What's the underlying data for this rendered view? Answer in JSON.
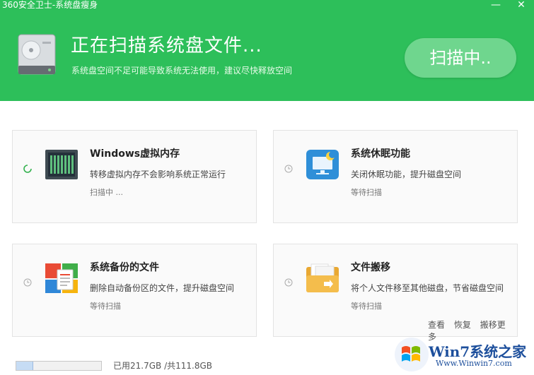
{
  "window": {
    "title": "360安全卫士-系统盘瘦身",
    "minimize_glyph": "—",
    "close_glyph": "✕"
  },
  "header": {
    "title": "正在扫描系统盘文件...",
    "subtitle": "系统盘空间不足可能导致系统无法使用，建议尽快释放空间",
    "scan_button": "扫描中..",
    "icon": "hard-disk-icon"
  },
  "cards": [
    {
      "title": "Windows虚拟内存",
      "desc": "转移虚拟内存不会影响系统正常运行",
      "status": "扫描中 ...",
      "icon": "memory-chip-icon",
      "state": "scanning"
    },
    {
      "title": "系统休眠功能",
      "desc": "关闭休眠功能，提升磁盘空间",
      "status": "等待扫描",
      "icon": "monitor-moon-icon",
      "state": "waiting"
    },
    {
      "title": "系统备份的文件",
      "desc": "删除自动备份区的文件，提升磁盘空间",
      "status": "等待扫描",
      "icon": "backup-files-icon",
      "state": "waiting"
    },
    {
      "title": "文件搬移",
      "desc": "将个人文件移至其他磁盘，节省磁盘空间",
      "status": "等待扫描",
      "icon": "folder-move-icon",
      "state": "waiting",
      "links": [
        "查看",
        "恢复",
        "搬移更多"
      ]
    }
  ],
  "footer": {
    "usage_text": "已用21.7GB /共111.8GB",
    "used_fraction": 0.194
  },
  "watermark": {
    "brand": "Win7系统之家",
    "url": "Www.Winwin7.com"
  },
  "colors": {
    "header_green": "#2dbf5a",
    "button_green": "#6fd68e"
  }
}
